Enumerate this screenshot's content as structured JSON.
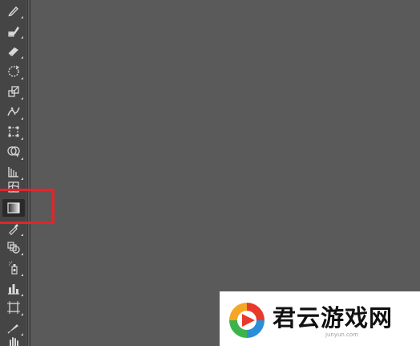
{
  "app": {
    "canvas_color": "#5a5a5a",
    "toolbar_color": "#454545"
  },
  "tools": [
    {
      "name": "pencil-tool",
      "icon": "pencil-icon",
      "active": false
    },
    {
      "name": "blob-brush-tool",
      "icon": "blob-brush-icon",
      "active": false
    },
    {
      "name": "eraser-tool",
      "icon": "eraser-icon",
      "active": false
    },
    {
      "name": "rotate-tool",
      "icon": "rotate-icon",
      "active": false
    },
    {
      "name": "scale-tool",
      "icon": "scale-icon",
      "active": false
    },
    {
      "name": "width-tool",
      "icon": "width-icon",
      "active": false
    },
    {
      "name": "free-transform-tool",
      "icon": "free-transform-icon",
      "active": false
    },
    {
      "name": "shape-builder-tool",
      "icon": "shape-builder-icon",
      "active": false
    },
    {
      "name": "perspective-grid-tool",
      "icon": "perspective-grid-icon",
      "active": false
    },
    {
      "name": "mesh-tool",
      "icon": "mesh-icon",
      "active": false
    },
    {
      "name": "gradient-tool",
      "icon": "gradient-icon",
      "active": true
    },
    {
      "name": "eyedropper-tool",
      "icon": "eyedropper-icon",
      "active": false
    },
    {
      "name": "blend-tool",
      "icon": "blend-icon",
      "active": false
    },
    {
      "name": "symbol-sprayer-tool",
      "icon": "symbol-sprayer-icon",
      "active": false
    },
    {
      "name": "column-graph-tool",
      "icon": "column-graph-icon",
      "active": false
    },
    {
      "name": "artboard-tool",
      "icon": "artboard-icon",
      "active": false
    },
    {
      "name": "slice-tool",
      "icon": "slice-icon",
      "active": false
    },
    {
      "name": "hand-tool",
      "icon": "hand-icon",
      "active": false
    }
  ],
  "highlight": {
    "color": "#e0262b",
    "target": "gradient-tool"
  },
  "watermark": {
    "title": "君云游戏网",
    "domain": "junyun.com",
    "logo_colors": [
      "#e8392b",
      "#f5a623",
      "#3cb44b",
      "#2a8fd6"
    ]
  }
}
